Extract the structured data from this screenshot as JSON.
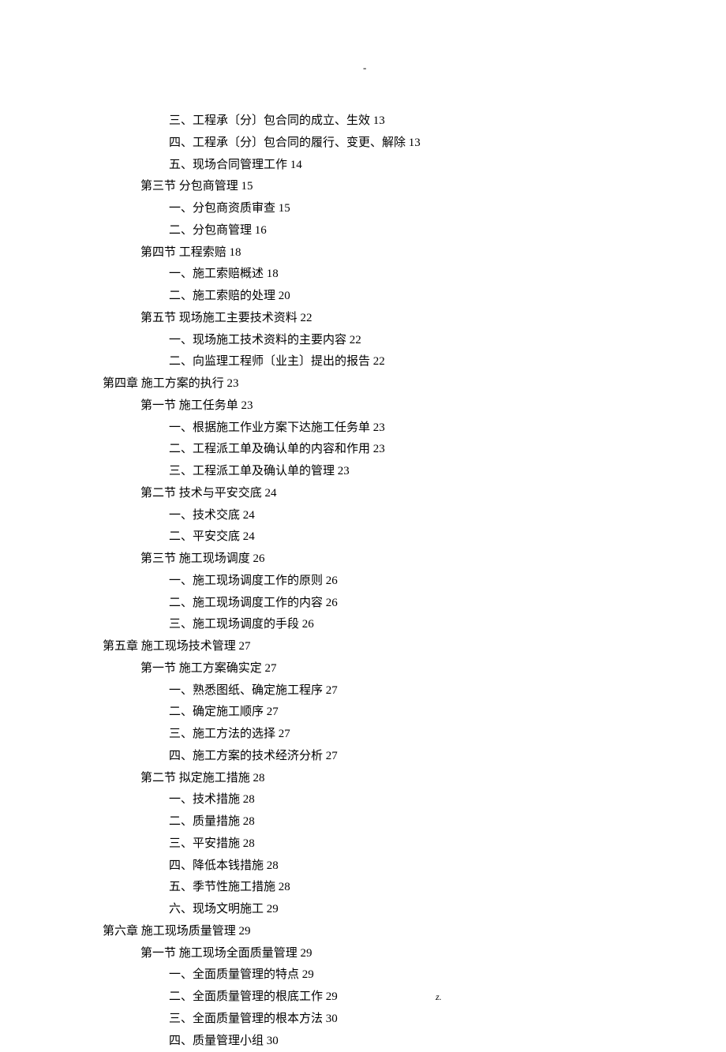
{
  "header_mark": "-",
  "footer_dot": ".",
  "footer_z": "z.",
  "toc": [
    {
      "level": 2,
      "text": "三、工程承〔分〕包合同的成立、生效",
      "page": "13"
    },
    {
      "level": 2,
      "text": "四、工程承〔分〕包合同的履行、变更、解除",
      "page": "13"
    },
    {
      "level": 2,
      "text": "五、现场合同管理工作",
      "page": "14"
    },
    {
      "level": 1,
      "text": "第三节   分包商管理",
      "page": "15"
    },
    {
      "level": 2,
      "text": "一、分包商资质审查",
      "page": "15"
    },
    {
      "level": 2,
      "text": "二、分包商管理",
      "page": "16"
    },
    {
      "level": 1,
      "text": "第四节   工程索赔",
      "page": "18"
    },
    {
      "level": 2,
      "text": "一、施工索赔概述",
      "page": "18"
    },
    {
      "level": 2,
      "text": "二、施工索赔的处理",
      "page": "20"
    },
    {
      "level": 1,
      "text": "第五节   现场施工主要技术资料",
      "page": "22"
    },
    {
      "level": 2,
      "text": "一、现场施工技术资料的主要内容",
      "page": "22"
    },
    {
      "level": 2,
      "text": "二、向监理工程师〔业主〕提出的报告",
      "page": "22"
    },
    {
      "level": 0,
      "text": "第四章  施工方案的执行",
      "page": "23"
    },
    {
      "level": 1,
      "text": "第一节  施工任务单",
      "page": "23"
    },
    {
      "level": 2,
      "text": "一、根据施工作业方案下达施工任务单",
      "page": "23"
    },
    {
      "level": 2,
      "text": "二、工程派工单及确认单的内容和作用",
      "page": "23"
    },
    {
      "level": 2,
      "text": "三、工程派工单及确认单的管理",
      "page": "23"
    },
    {
      "level": 1,
      "text": "第二节   技术与平安交底",
      "page": "24"
    },
    {
      "level": 2,
      "text": "一、技术交底",
      "page": "24"
    },
    {
      "level": 2,
      "text": "二、平安交底",
      "page": "24"
    },
    {
      "level": 1,
      "text": "第三节   施工现场调度",
      "page": "26"
    },
    {
      "level": 2,
      "text": "一、施工现场调度工作的原则",
      "page": "26"
    },
    {
      "level": 2,
      "text": "二、施工现场调度工作的内容",
      "page": "26"
    },
    {
      "level": 2,
      "text": "三、施工现场调度的手段",
      "page": "26"
    },
    {
      "level": 0,
      "text": "第五章  施工现场技术管理",
      "page": "27"
    },
    {
      "level": 1,
      "text": "第一节  施工方案确实定",
      "page": "27"
    },
    {
      "level": 2,
      "text": "一、熟悉图纸、确定施工程序",
      "page": "27"
    },
    {
      "level": 2,
      "text": "二、确定施工顺序",
      "page": "27"
    },
    {
      "level": 2,
      "text": "三、施工方法的选择",
      "page": "27"
    },
    {
      "level": 2,
      "text": "四、施工方案的技术经济分析",
      "page": "27"
    },
    {
      "level": 1,
      "text": "第二节   拟定施工措施",
      "page": "28"
    },
    {
      "level": 2,
      "text": "一、技术措施",
      "page": "28"
    },
    {
      "level": 2,
      "text": "二、质量措施",
      "page": "28"
    },
    {
      "level": 2,
      "text": "三、平安措施",
      "page": "28"
    },
    {
      "level": 2,
      "text": "四、降低本钱措施",
      "page": "28"
    },
    {
      "level": 2,
      "text": "五、季节性施工措施",
      "page": "28"
    },
    {
      "level": 2,
      "text": "六、现场文明施工",
      "page": "29"
    },
    {
      "level": 0,
      "text": "第六章  施工现场质量管理",
      "page": "29"
    },
    {
      "level": 1,
      "text": "第一节  施工现场全面质量管理",
      "page": "29"
    },
    {
      "level": 2,
      "text": "一、全面质量管理的特点",
      "page": "29"
    },
    {
      "level": 2,
      "text": "二、全面质量管理的根底工作",
      "page": "29"
    },
    {
      "level": 2,
      "text": "三、全面质量管理的根本方法",
      "page": "30"
    },
    {
      "level": 2,
      "text": "四、质量管理小组",
      "page": "30"
    }
  ]
}
